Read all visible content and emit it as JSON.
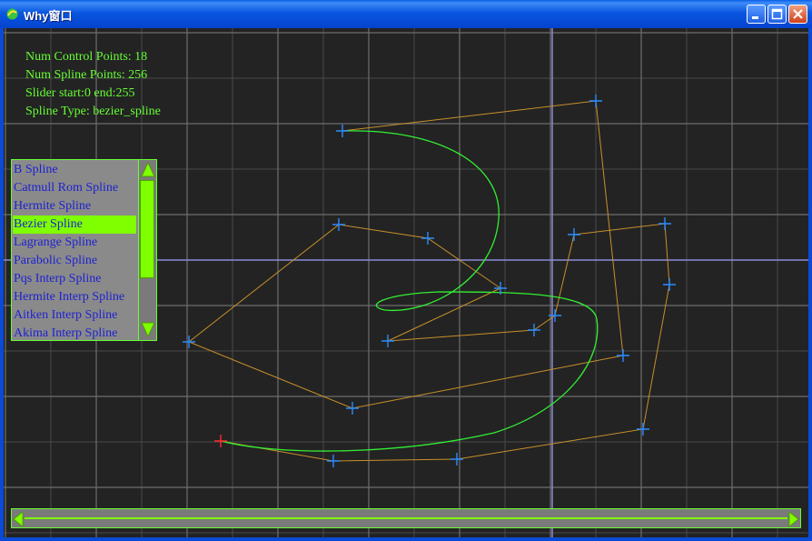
{
  "window": {
    "title": "Why窗口",
    "buttons": {
      "minimize": "minimize",
      "maximize": "maximize",
      "close": "close"
    }
  },
  "info": {
    "num_control_points": "Num Control Points: 18",
    "num_spline_points": "Num Spline Points: 256",
    "slider": "Slider start:0 end:255",
    "spline_type": "Spline Type: bezier_spline"
  },
  "spline_list": {
    "items": [
      "B Spline",
      "Catmull Rom Spline",
      "Hermite Spline",
      "Bezier Spline",
      "Lagrange Spline",
      "Parabolic Spline",
      "Pqs Interp Spline",
      "Hermite Interp Spline",
      "Aitken Interp Spline",
      "Akima Interp Spline"
    ],
    "selected_index": 3
  },
  "slider": {
    "start": 0,
    "end": 255
  },
  "colors": {
    "background": "#232323",
    "grid": "#6e6e6e",
    "axis": "#8a8ad8",
    "control_polygon": "#c8902a",
    "spline": "#33ee33",
    "control_marker": "#2a8cff",
    "first_marker": "#ff2a2a",
    "text": "#66ff33",
    "list_text": "#1e22d0",
    "selection": "#7fff00"
  }
}
